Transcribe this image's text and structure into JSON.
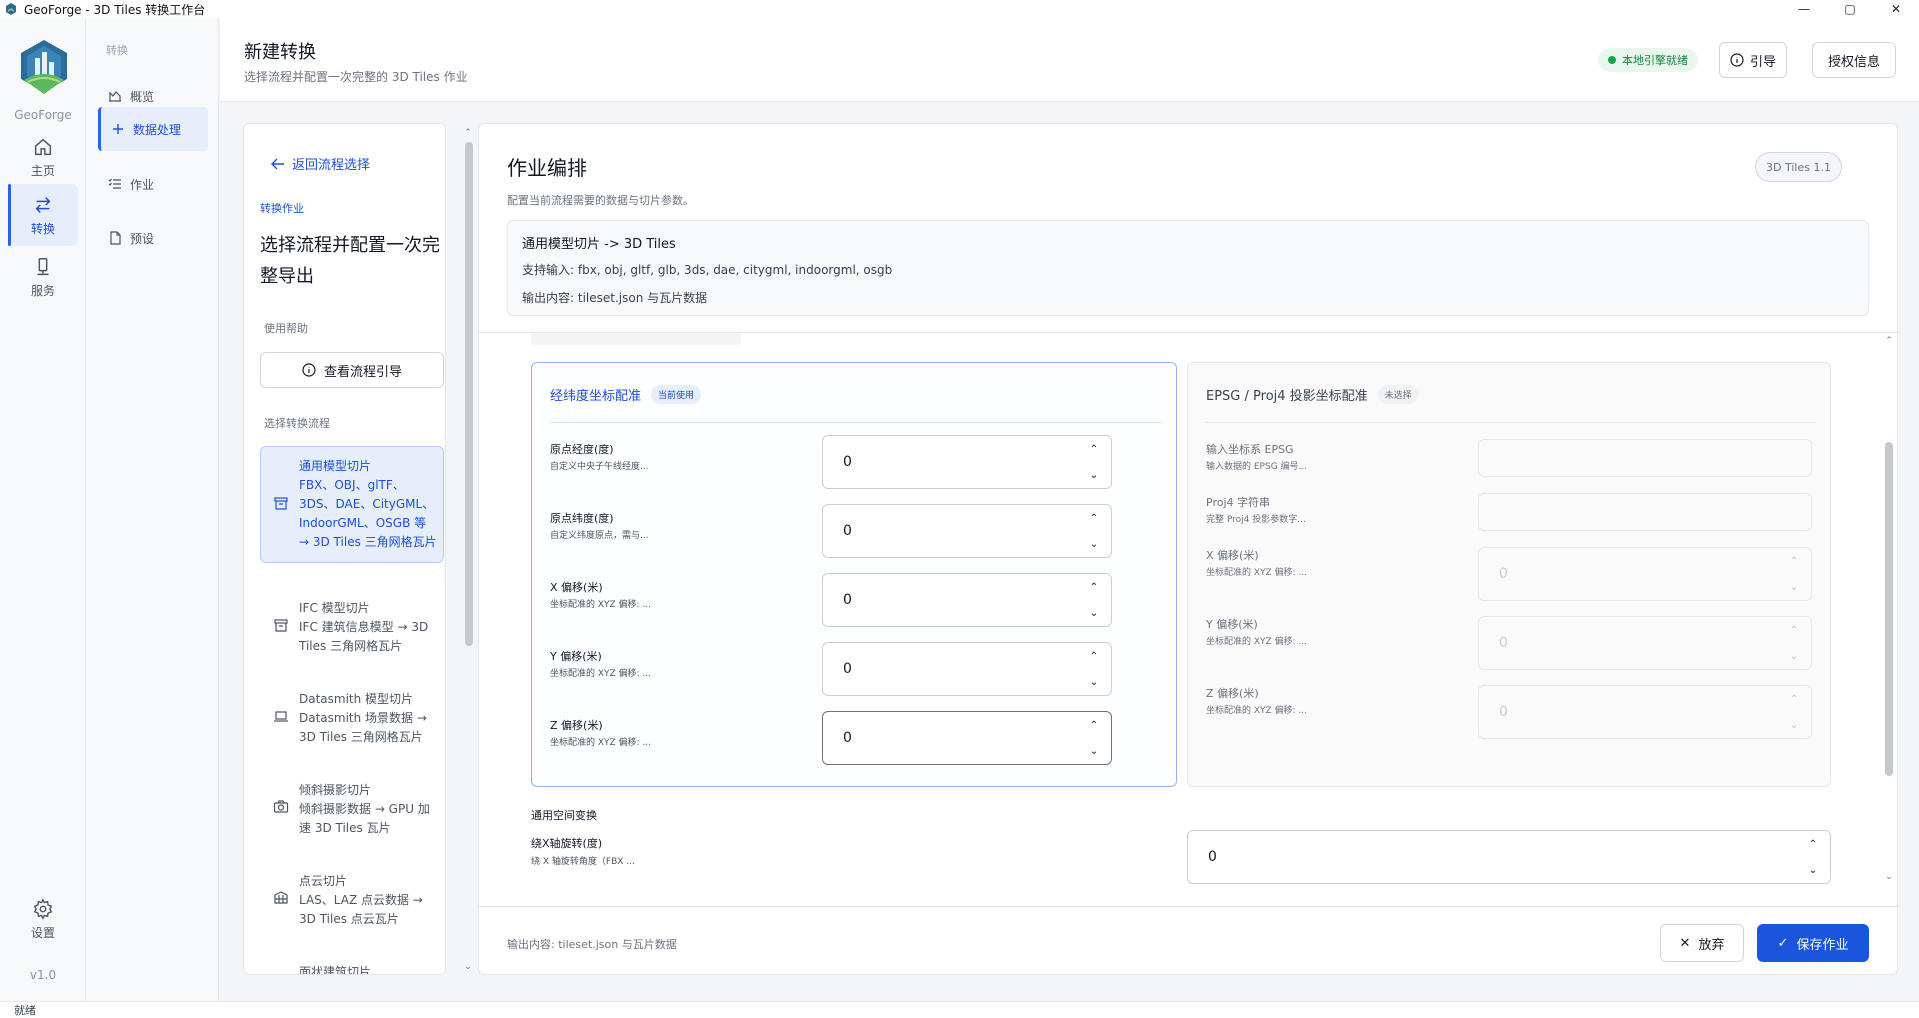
{
  "window": {
    "title": "GeoForge - 3D Tiles 转换工作台",
    "controls": {
      "minimize": "—",
      "maximize": "▢",
      "close": "✕"
    }
  },
  "rail": {
    "logo_text": "GeoForge",
    "items": [
      {
        "label": "主页",
        "icon": "home-icon"
      },
      {
        "label": "转换",
        "icon": "swap-icon",
        "active": true
      },
      {
        "label": "服务",
        "icon": "server-icon"
      }
    ],
    "settings_label": "设置",
    "version": "v1.0"
  },
  "subnav": {
    "group_title": "转换",
    "items": [
      {
        "label": "概览",
        "icon": "overview-icon"
      },
      {
        "label": "数据处理",
        "icon": "plus-icon",
        "active": true
      },
      {
        "label": "作业",
        "icon": "list-icon"
      },
      {
        "label": "预设",
        "icon": "document-icon"
      }
    ]
  },
  "header": {
    "title": "新建转换",
    "subtitle": "选择流程并配置一次完整的 3D Tiles 作业",
    "engine_status": "本地引擎就绪",
    "guide_label": "引导",
    "license_label": "授权信息"
  },
  "left_panel": {
    "back_label": "返回流程选择",
    "eyebrow": "转换作业",
    "title": "选择流程并配置一次完整导出",
    "help_label": "使用帮助",
    "guide_button": "查看流程引导",
    "flow_label": "选择转换流程",
    "flows": [
      {
        "title": "通用模型切片",
        "desc": "FBX、OBJ、glTF、3DS、DAE、CityGML、IndoorGML、OSGB 等 → 3D Tiles 三角网格瓦片",
        "icon": "box-icon",
        "active": true
      },
      {
        "title": "IFC 模型切片",
        "desc": "IFC 建筑信息模型 → 3D Tiles 三角网格瓦片",
        "icon": "box-icon"
      },
      {
        "title": "Datasmith 模型切片",
        "desc": "Datasmith 场景数据 → 3D Tiles 三角网格瓦片",
        "icon": "laptop-icon"
      },
      {
        "title": "倾斜摄影切片",
        "desc": "倾斜摄影数据 → GPU 加速 3D Tiles 瓦片",
        "icon": "camera-icon"
      },
      {
        "title": "点云切片",
        "desc": "LAS、LAZ 点云数据 → 3D Tiles 点云瓦片",
        "icon": "grid-icon"
      },
      {
        "title": "面状建筑切片",
        "desc": "",
        "icon": "building-icon"
      }
    ]
  },
  "main": {
    "title": "作业编排",
    "subtitle": "配置当前流程需要的数据与切片参数。",
    "version_chip": "3D Tiles 1.1",
    "summary": {
      "flow": "通用模型切片 -> 3D Tiles",
      "inputs": "支持输入: fbx, obj, gltf, glb, 3ds, dae, citygml, indoorgml, osgb",
      "outputs": "输出内容: tileset.json 与瓦片数据"
    },
    "geo_box": {
      "title": "经纬度坐标配准",
      "tag": "当前使用",
      "fields": [
        {
          "label": "原点经度(度)",
          "hint": "自定义中央子午线经度...",
          "value": "0"
        },
        {
          "label": "原点纬度(度)",
          "hint": "自定义纬度原点，需与...",
          "value": "0"
        },
        {
          "label": "X 偏移(米)",
          "hint": "坐标配准的 XYZ 偏移: ...",
          "value": "0"
        },
        {
          "label": "Y 偏移(米)",
          "hint": "坐标配准的 XYZ 偏移: ...",
          "value": "0"
        },
        {
          "label": "Z 偏移(米)",
          "hint": "坐标配准的 XYZ 偏移: ...",
          "value": "0"
        }
      ]
    },
    "proj_box": {
      "title": "EPSG / Proj4 投影坐标配准",
      "tag": "未选择",
      "fields": [
        {
          "label": "输入坐标系 EPSG",
          "hint": "输入数据的 EPSG 编号...",
          "value": ""
        },
        {
          "label": "Proj4 字符串",
          "hint": "完整 Proj4 投影参数字...",
          "value": ""
        },
        {
          "label": "X 偏移(米)",
          "hint": "坐标配准的 XYZ 偏移: ...",
          "value": "0"
        },
        {
          "label": "Y 偏移(米)",
          "hint": "坐标配准的 XYZ 偏移: ...",
          "value": "0"
        },
        {
          "label": "Z 偏移(米)",
          "hint": "坐标配准的 XYZ 偏移: ...",
          "value": "0"
        }
      ]
    },
    "spatial": {
      "section_title": "通用空间变换",
      "rot_label": "绕X轴旋转(度)",
      "rot_hint": "绕 X 轴旋转角度（FBX ...",
      "rot_value": "0"
    },
    "footer_note": "输出内容: tileset.json 与瓦片数据",
    "discard_label": "放弃",
    "save_label": "保存作业"
  },
  "statusbar": {
    "text": "就绪"
  },
  "colors": {
    "accent": "#1a56db",
    "active_bg": "#e6eefc",
    "ready_green": "#16a34a"
  }
}
